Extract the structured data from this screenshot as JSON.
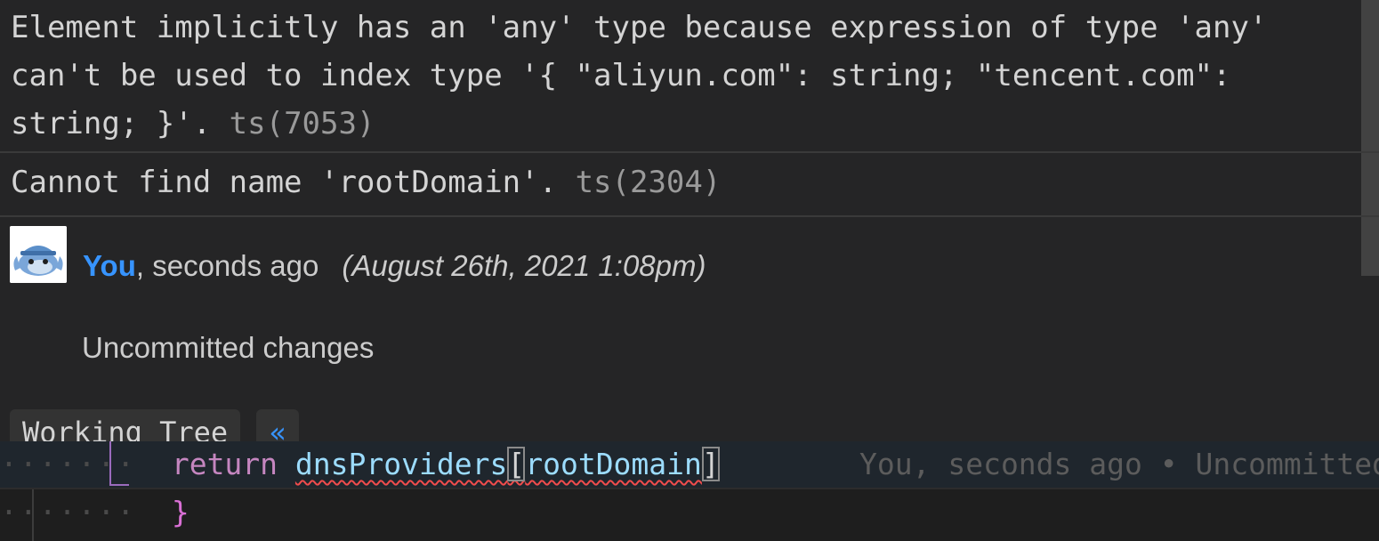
{
  "hover": {
    "diagnostics": [
      {
        "message": "Element implicitly has an 'any' type because expression of type 'any' can't be used to index type '{ \"aliyun.com\": string; \"tencent.com\": string; }'.",
        "code": "ts(7053)"
      },
      {
        "message": "Cannot find name 'rootDomain'.",
        "code": "ts(2304)"
      }
    ],
    "blame": {
      "author": "You",
      "relative_time": ", seconds ago",
      "date": "(August 26th, 2021 1:08pm)",
      "message": "Uncommitted changes",
      "actions": {
        "working_tree_label": "Working Tree",
        "navigate_icon": "«"
      }
    }
  },
  "editor": {
    "line1": {
      "whitespace": "·······",
      "keyword": "return",
      "object": "dnsProviders",
      "open_bracket": "[",
      "index": "rootDomain",
      "close_bracket": "]",
      "inline_blame": "You, seconds ago • Uncommitted changes"
    },
    "line2": {
      "whitespace": "·······",
      "brace": "}"
    }
  },
  "colors": {
    "background": "#1e1e1e",
    "hover_background": "#252526",
    "accent_link": "#3794ff",
    "error_squiggle": "#f14c4c",
    "keyword": "#c586c0",
    "identifier": "#9cdcfe"
  }
}
